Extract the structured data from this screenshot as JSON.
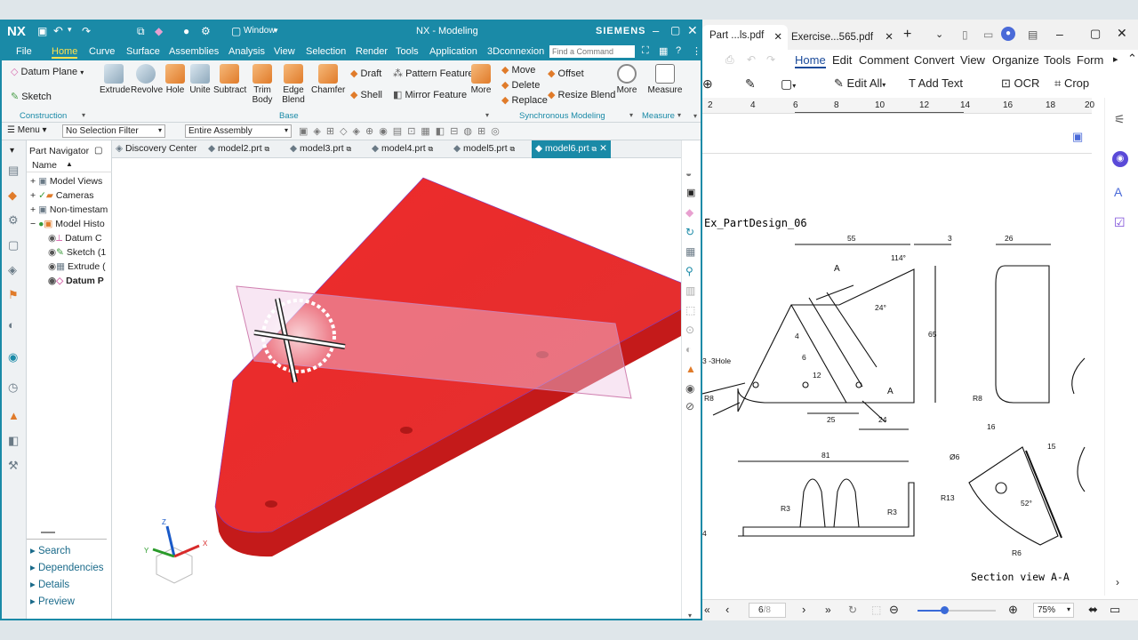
{
  "nx": {
    "logo": "NX",
    "window_menu": "Window",
    "title": "NX - Modeling",
    "brand": "SIEMENS",
    "menu": [
      "File",
      "Home",
      "Curve",
      "Surface",
      "Assemblies",
      "Analysis",
      "View",
      "Selection",
      "Render",
      "Tools",
      "Application",
      "3Dconnexion"
    ],
    "find_placeholder": "Find a Command",
    "ribbon": {
      "datum_plane": "Datum Plane",
      "sketch": "Sketch",
      "construction": "Construction",
      "extrude": "Extrude",
      "revolve": "Revolve",
      "hole": "Hole",
      "unite": "Unite",
      "subtract": "Subtract",
      "trim_body": "Trim Body",
      "edge_blend": "Edge Blend",
      "chamfer": "Chamfer",
      "draft": "Draft",
      "shell": "Shell",
      "pattern_feature": "Pattern Feature",
      "mirror_feature": "Mirror Feature",
      "more1": "More",
      "base": "Base",
      "move": "Move",
      "delete": "Delete",
      "replace": "Replace",
      "offset": "Offset",
      "resize_blend": "Resize Blend",
      "more2": "More",
      "synchronous": "Synchronous Modeling",
      "measure": "Measure",
      "measure_group": "Measure"
    },
    "selbar": {
      "menu": "Menu",
      "filter": "No Selection Filter",
      "scope": "Entire Assembly"
    },
    "navigator": {
      "title": "Part Navigator",
      "col_name": "Name",
      "rows": [
        "Model Views",
        "Cameras",
        "Non-timestam",
        "Model Histo",
        "Datum C",
        "Sketch (1",
        "Extrude (",
        "Datum P"
      ],
      "sections": [
        "Search",
        "Dependencies",
        "Details",
        "Preview"
      ]
    },
    "tabs": [
      "Discovery Center",
      "model2.prt",
      "model3.prt",
      "model4.prt",
      "model5.prt",
      "model6.prt"
    ],
    "axes": {
      "x": "X",
      "y": "Y",
      "z": "Z"
    }
  },
  "pdf": {
    "tab1": "Part ...ls.pdf",
    "tab2": "Exercise...565.pdf",
    "menu": [
      "Home",
      "Edit",
      "Comment",
      "Convert",
      "View",
      "Organize",
      "Tools",
      "Form"
    ],
    "tools": {
      "edit_all": "Edit All",
      "add_text": "Add Text",
      "ocr": "OCR",
      "crop": "Crop"
    },
    "ruler": [
      "2",
      "4",
      "6",
      "8",
      "10",
      "12",
      "14",
      "16",
      "18",
      "20"
    ],
    "drawing": {
      "title": "Ex_PartDesign_06",
      "section": "Section view A-A",
      "dims": [
        "55",
        "3",
        "26",
        "114°",
        "A",
        "24°",
        "65",
        "4",
        "6",
        "12",
        "A",
        "3 -3Hole",
        "R8",
        "25",
        "24",
        "R8",
        "16",
        "15",
        "Ø6",
        "R13",
        "52°",
        "R6",
        "81",
        "R3",
        "R3",
        "4"
      ]
    },
    "page": "6",
    "page_total": "/8",
    "zoom": "75%"
  }
}
